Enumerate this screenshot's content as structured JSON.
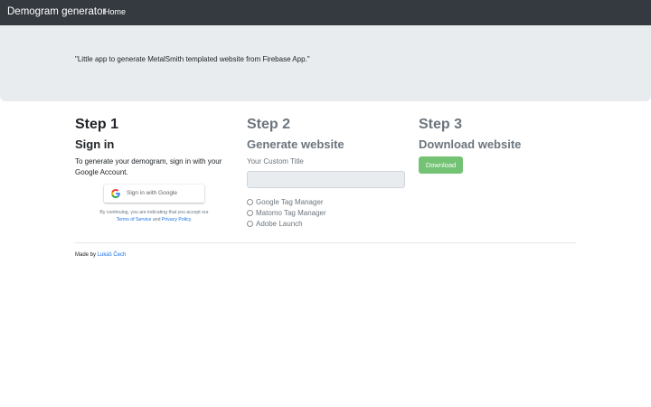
{
  "navbar": {
    "brand": "Demogram generator",
    "home_label": "Home"
  },
  "jumbotron": {
    "lead": "\"Little app to generate MetalSmith templated website from Firebase App.\""
  },
  "steps": [
    {
      "title": "Step 1",
      "subtitle": "Sign in",
      "description": "To generate your demogram, sign in with your Google Account.",
      "google_button_label": "Sign in with Google",
      "google_icon": "google-g-icon",
      "tos_prefix": "By continuing, you are indicating that you accept our",
      "tos_link": "Terms of Service",
      "tos_and": "and",
      "privacy_link": "Privacy Policy",
      "tos_suffix": "."
    },
    {
      "title": "Step 2",
      "subtitle": "Generate website",
      "field_label": "Your Custom Title",
      "field_value": "",
      "options": [
        "Google Tag Manager",
        "Matomo Tag Manager",
        "Adobe Launch"
      ]
    },
    {
      "title": "Step 3",
      "subtitle": "Download website",
      "download_label": "Download"
    }
  ],
  "footer": {
    "prefix": "Made by",
    "author": "Lukáš Čech"
  },
  "colors": {
    "navbar_bg": "#343a40",
    "jumbotron_bg": "#e9ecef",
    "download_bg": "#5cb85c",
    "link": "#1a73e8",
    "muted_text": "#6c757d"
  }
}
